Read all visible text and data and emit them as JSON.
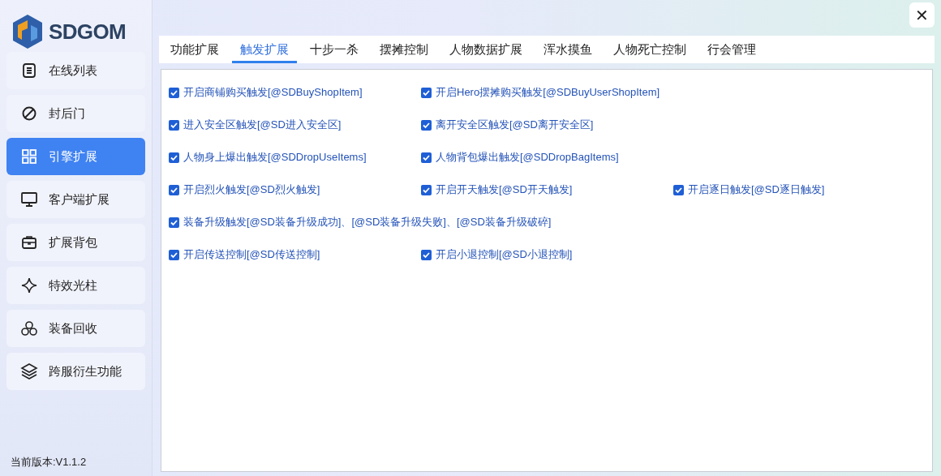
{
  "logo": {
    "text": "SDGOM"
  },
  "sidebar": {
    "items": [
      {
        "label": "在线列表",
        "selected": false
      },
      {
        "label": "封后门",
        "selected": false
      },
      {
        "label": "引擎扩展",
        "selected": true
      },
      {
        "label": "客户端扩展",
        "selected": false
      },
      {
        "label": "扩展背包",
        "selected": false
      },
      {
        "label": "特效光柱",
        "selected": false
      },
      {
        "label": "装备回收",
        "selected": false
      },
      {
        "label": "跨服衍生功能",
        "selected": false
      }
    ],
    "version": "当前版本:V1.1.2"
  },
  "close_button": {
    "label": "✕"
  },
  "tabs": [
    {
      "label": "功能扩展",
      "selected": false
    },
    {
      "label": "触发扩展",
      "selected": true
    },
    {
      "label": "十步一杀",
      "selected": false
    },
    {
      "label": "摆摊控制",
      "selected": false
    },
    {
      "label": "人物数据扩展",
      "selected": false
    },
    {
      "label": "浑水摸鱼",
      "selected": false
    },
    {
      "label": "人物死亡控制",
      "selected": false
    },
    {
      "label": "行会管理",
      "selected": false
    }
  ],
  "options": [
    [
      {
        "label": "开启商铺购买触发[@SDBuyShopItem]",
        "checked": true
      },
      {
        "label": "开启Hero摆摊购买触发[@SDBuyUserShopItem]",
        "checked": true
      }
    ],
    [
      {
        "label": "进入安全区触发[@SD进入安全区]",
        "checked": true
      },
      {
        "label": "离开安全区触发[@SD离开安全区]",
        "checked": true
      }
    ],
    [
      {
        "label": "人物身上爆出触发[@SDDropUseItems]",
        "checked": true
      },
      {
        "label": "人物背包爆出触发[@SDDropBagItems]",
        "checked": true
      }
    ],
    [
      {
        "label": "开启烈火触发[@SD烈火触发]",
        "checked": true
      },
      {
        "label": "开启开天触发[@SD开天触发]",
        "checked": true
      },
      {
        "label": "开启逐日触发[@SD逐日触发]",
        "checked": true
      }
    ],
    [
      {
        "label": "装备升级触发[@SD装备升级成功]、[@SD装备升级失败]、[@SD装备升级破碎]",
        "checked": true
      }
    ],
    [
      {
        "label": "开启传送控制[@SD传送控制]",
        "checked": true
      },
      {
        "label": "开启小退控制[@SD小退控制]",
        "checked": true
      }
    ]
  ]
}
